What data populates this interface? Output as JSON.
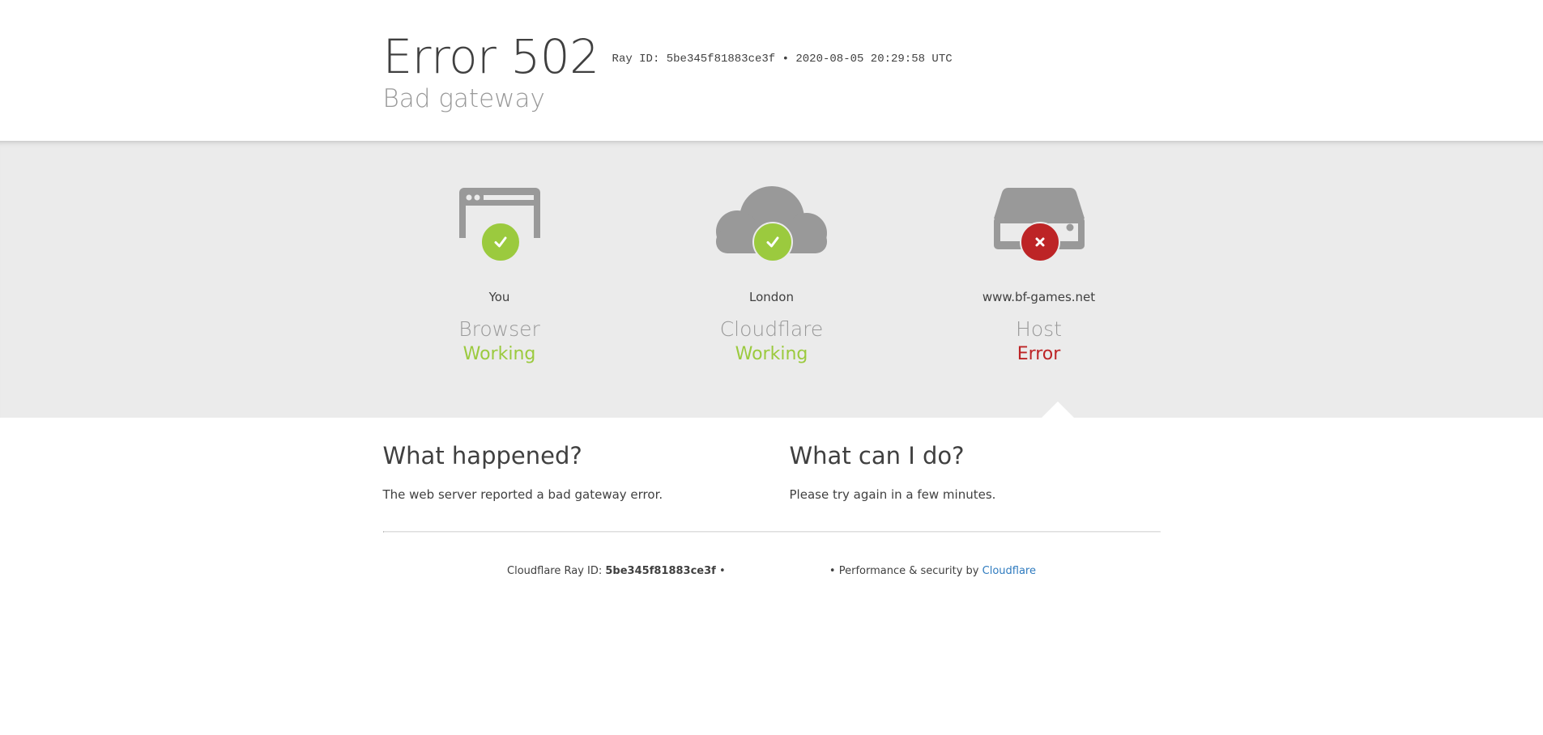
{
  "header": {
    "title": "Error 502",
    "ray_line": "Ray ID: 5be345f81883ce3f • 2020-08-05 20:29:58 UTC",
    "subtitle": "Bad gateway"
  },
  "nodes": [
    {
      "location": "You",
      "name": "Browser",
      "status": "Working",
      "icon": "browser-icon",
      "state": "ok"
    },
    {
      "location": "London",
      "name": "Cloudflare",
      "status": "Working",
      "icon": "cloud-icon",
      "state": "ok"
    },
    {
      "location": "www.bf-games.net",
      "name": "Host",
      "status": "Error",
      "icon": "server-icon",
      "state": "error"
    }
  ],
  "colors": {
    "ok": "#9bca3e",
    "error": "#bd2426",
    "icon_gray": "#999999",
    "band_bg": "#ebebeb",
    "link": "#2f7bbf"
  },
  "info": {
    "what_happened_title": "What happened?",
    "what_happened_text": "The web server reported a bad gateway error.",
    "what_can_i_do_title": "What can I do?",
    "what_can_i_do_text": "Please try again in a few minutes."
  },
  "footer": {
    "ray_label": "Cloudflare Ray ID: ",
    "ray_id": "5be345f81883ce3f",
    "bullet": "•",
    "perf_text": "Performance & security by ",
    "cloudflare_link": "Cloudflare"
  }
}
